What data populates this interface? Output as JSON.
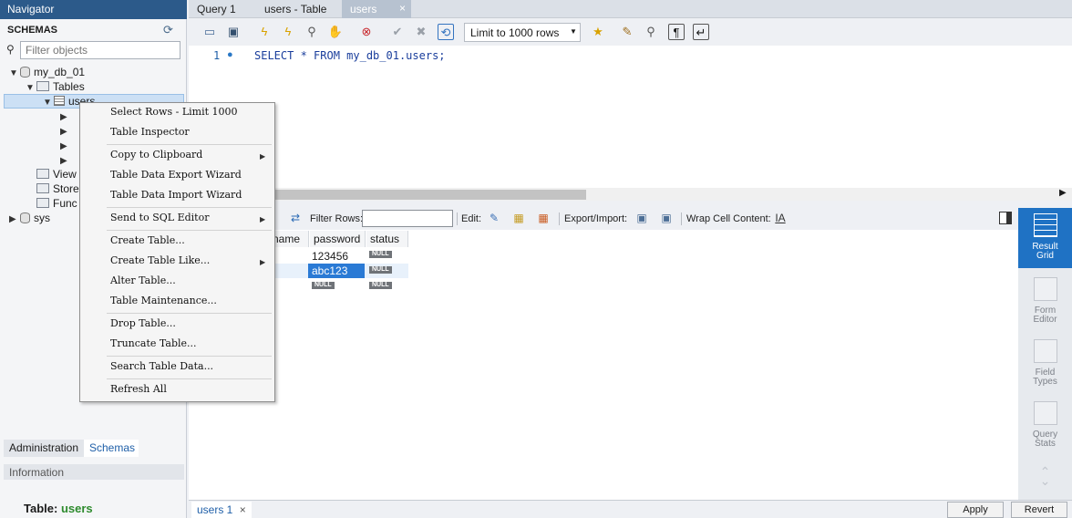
{
  "navigator": {
    "title": "Navigator",
    "schemas_label": "SCHEMAS",
    "filter_placeholder": "Filter objects",
    "tree": {
      "db1": "my_db_01",
      "tables": "Tables",
      "table_users": "users",
      "views": "View",
      "stored": "Store",
      "functions": "Func",
      "db2": "sys"
    },
    "bottom_tabs": {
      "admin": "Administration",
      "schemas": "Schemas"
    },
    "info_label": "Information",
    "table_prefix": "Table:",
    "table_name": "users"
  },
  "tabs": {
    "t1": "Query 1",
    "t2": "users - Table",
    "t3": "users"
  },
  "toolbar": {
    "limit": "Limit to 1000 rows"
  },
  "editor": {
    "line": "1",
    "sql": "SELECT * FROM my_db_01.users;"
  },
  "result_toolbar": {
    "filter_rows": "Filter Rows:",
    "edit": "Edit:",
    "export_import": "Export/Import:",
    "wrap": "Wrap Cell Content:"
  },
  "grid": {
    "columns": [
      "name",
      "password",
      "status"
    ],
    "rows": [
      {
        "password": "123456",
        "status": "NULL"
      },
      {
        "password": "abc123",
        "status": "NULL"
      },
      {
        "password": "NULL",
        "status": "NULL"
      }
    ]
  },
  "result_tab": "users 1",
  "buttons": {
    "apply": "Apply",
    "revert": "Revert"
  },
  "side_panel": {
    "result_grid": "Result Grid",
    "form_editor": "Form Editor",
    "field_types": "Field Types",
    "query_stats": "Query Stats"
  },
  "context_menu": [
    "Select Rows - Limit 1000",
    "Table Inspector",
    "Copy to Clipboard",
    "Table Data Export Wizard",
    "Table Data Import Wizard",
    "Send to SQL Editor",
    "Create Table...",
    "Create Table Like...",
    "Alter Table...",
    "Table Maintenance...",
    "Drop Table...",
    "Truncate Table...",
    "Search Table Data...",
    "Refresh All"
  ]
}
